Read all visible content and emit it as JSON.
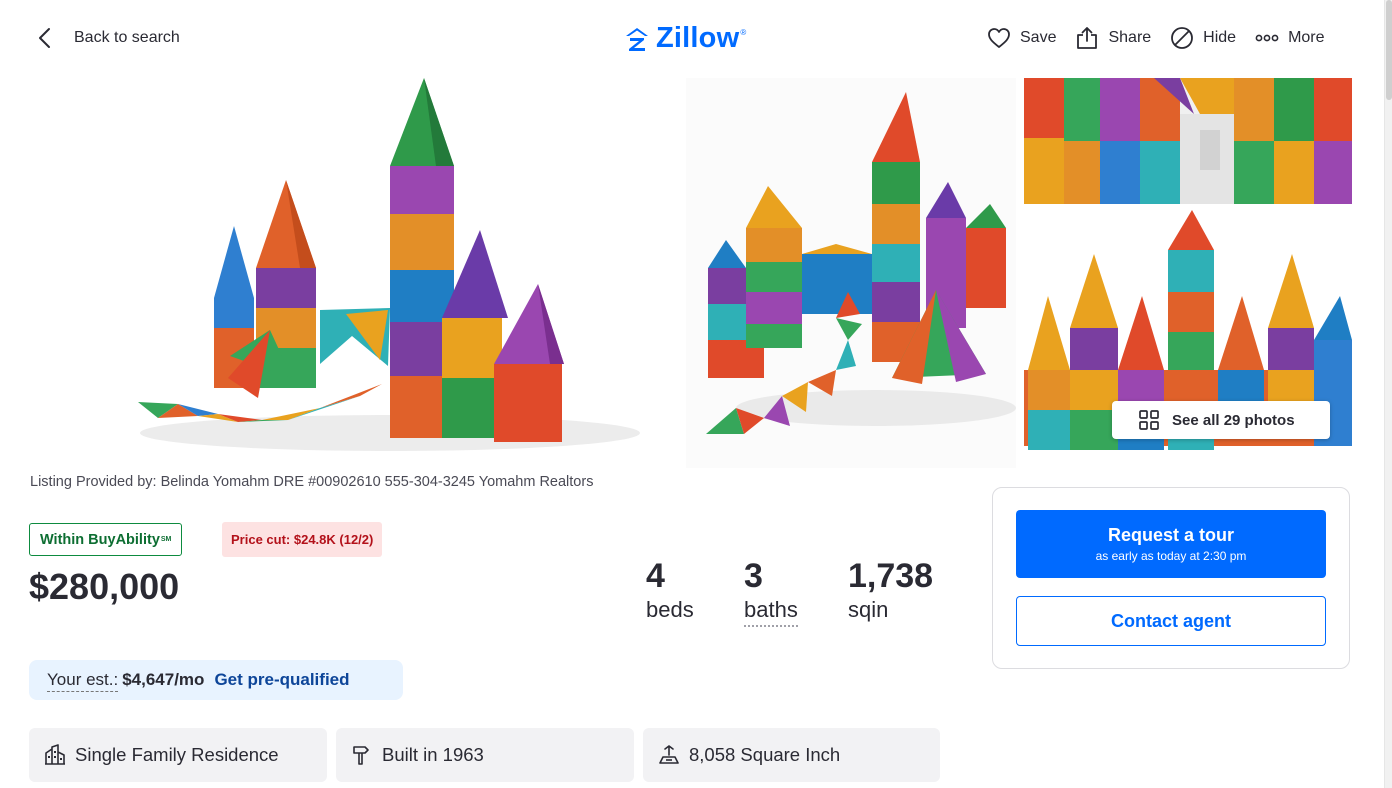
{
  "header": {
    "back_label": "Back to search",
    "logo_text": "Zillow",
    "logo_mark": "®",
    "actions": [
      {
        "label": "Save",
        "icon": "heart-icon"
      },
      {
        "label": "Share",
        "icon": "share-icon"
      },
      {
        "label": "Hide",
        "icon": "hide-icon"
      },
      {
        "label": "More",
        "icon": "more-icon"
      }
    ]
  },
  "gallery": {
    "see_all_label": "See all 29 photos",
    "photos": [
      "magnetic-tile-castle-photo",
      "magnetic-tile-tower-photo",
      "magnetic-tile-arch-photo",
      "magnetic-tile-skyline-photo"
    ]
  },
  "listing": {
    "provided_by": "Listing Provided by: Belinda Yomahm DRE #00902610 555-304-3245 Yomahm Realtors",
    "buyability_badge": "Within BuyAbility",
    "buyability_mark": "SM",
    "price_cut": "Price cut: $24.8K (12/2)",
    "price": "$280,000",
    "facts": [
      {
        "value": "4",
        "unit": "beds"
      },
      {
        "value": "3",
        "unit": "baths"
      },
      {
        "value": "1,738",
        "unit": "sqin"
      }
    ],
    "estimate": {
      "label": "Your est.:",
      "value": "$4,647/mo",
      "link": "Get pre-qualified"
    },
    "chips": [
      {
        "label": "Single Family Residence",
        "icon": "home-type-icon"
      },
      {
        "label": "Built in 1963",
        "icon": "hammer-icon"
      },
      {
        "label": "8,058 Square Inch",
        "icon": "lot-size-icon"
      }
    ]
  },
  "cta": {
    "tour_title": "Request a tour",
    "tour_subtitle": "as early as today at 2:30 pm",
    "contact_label": "Contact agent"
  },
  "colors": {
    "brand": "#006aff",
    "buyability_green": "#0d8b3f",
    "price_cut_bg": "#fde2e2",
    "price_cut_text": "#b3111a",
    "estimate_bg": "#e8f3ff",
    "link_dark_blue": "#0d4599"
  }
}
